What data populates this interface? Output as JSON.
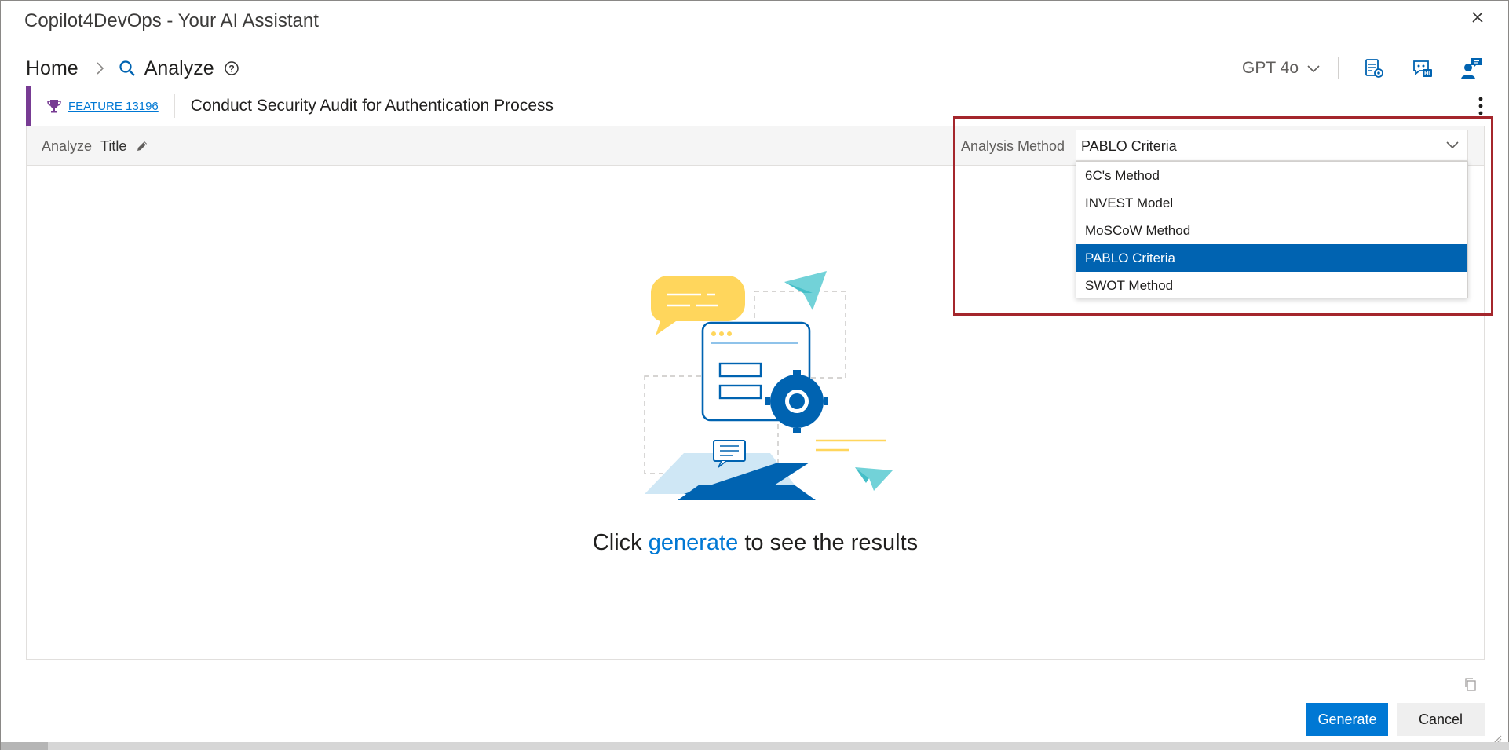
{
  "window": {
    "title": "Copilot4DevOps - Your AI Assistant",
    "close_icon": "close-icon"
  },
  "breadcrumb": {
    "home": "Home",
    "current": "Analyze"
  },
  "header": {
    "model": "GPT 4o",
    "icons": [
      "document-settings-icon",
      "chat-assistant-icon",
      "user-feedback-icon"
    ]
  },
  "feature": {
    "link": "FEATURE 13196",
    "title": "Conduct Security Audit for Authentication Process",
    "accent_color": "#773b93"
  },
  "toolbar": {
    "analyze_label": "Analyze",
    "field_label": "Title",
    "method_label": "Analysis Method"
  },
  "method_select": {
    "value": "PABLO Criteria",
    "options": [
      "6C's Method",
      "INVEST Model",
      "MoSCoW Method",
      "PABLO Criteria",
      "SWOT Method"
    ],
    "selected_index": 3
  },
  "empty_state": {
    "prefix": "Click",
    "link": "generate",
    "suffix": "to see the results"
  },
  "footer": {
    "generate": "Generate",
    "cancel": "Cancel"
  },
  "colors": {
    "primary": "#0078d4",
    "selected_option": "#0063b1",
    "highlight_border": "#a4262c"
  }
}
